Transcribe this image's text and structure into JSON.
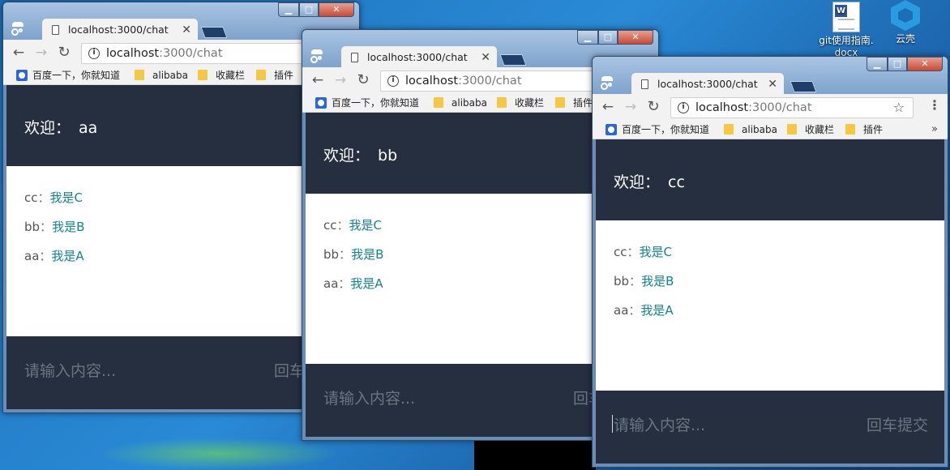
{
  "desktop": {
    "icons": [
      {
        "label_line1": "git使用指南.",
        "label_line2": "docx",
        "icon": "word-doc-icon"
      },
      {
        "label": "云壳",
        "icon": "cloud-hexagon-icon"
      }
    ]
  },
  "windows": [
    {
      "tab_title": "localhost:3000/chat",
      "url_host": "localhost",
      "url_path": ":3000/chat",
      "bookmarks": [
        "百度一下，你就知道",
        "alibaba",
        "收藏栏",
        "插件"
      ],
      "welcome_label": "欢迎：",
      "user": "aa",
      "messages": [
        {
          "from": "cc",
          "sep": "：",
          "text": "我是C"
        },
        {
          "from": "bb",
          "sep": "：",
          "text": "我是B"
        },
        {
          "from": "aa",
          "sep": "：",
          "text": "我是A"
        }
      ],
      "input_placeholder": "请输入内容...",
      "submit_label": "回车"
    },
    {
      "tab_title": "localhost:3000/chat",
      "url_host": "localhost",
      "url_path": ":3000/chat",
      "bookmarks": [
        "百度一下，你就知道",
        "alibaba",
        "收藏栏",
        "插件"
      ],
      "welcome_label": "欢迎：",
      "user": "bb",
      "messages": [
        {
          "from": "cc",
          "sep": "：",
          "text": "我是C"
        },
        {
          "from": "bb",
          "sep": "：",
          "text": "我是B"
        },
        {
          "from": "aa",
          "sep": "：",
          "text": "我是A"
        }
      ],
      "input_placeholder": "请输入内容...",
      "submit_label": "回车"
    },
    {
      "tab_title": "localhost:3000/chat",
      "url_host": "localhost",
      "url_path": ":3000/chat",
      "bookmarks": [
        "百度一下，你就知道",
        "alibaba",
        "收藏栏",
        "插件"
      ],
      "bookmarks_more": "»",
      "welcome_label": "欢迎：",
      "user": "cc",
      "messages": [
        {
          "from": "cc",
          "sep": "：",
          "text": "我是C"
        },
        {
          "from": "bb",
          "sep": "：",
          "text": "我是B"
        },
        {
          "from": "aa",
          "sep": "：",
          "text": "我是A"
        }
      ],
      "input_placeholder": "请输入内容...",
      "submit_label": "回车提交"
    }
  ],
  "colors": {
    "header_bg": "#252f40",
    "message_text": "#15838a",
    "placeholder": "#6c7480"
  }
}
